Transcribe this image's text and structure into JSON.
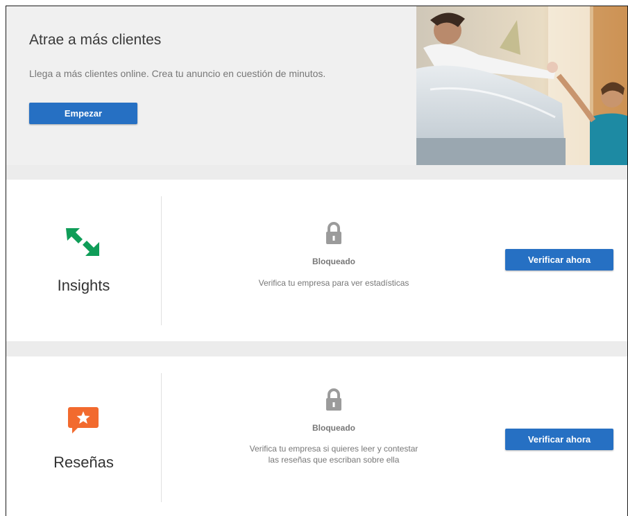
{
  "promo": {
    "title": "Atrae a más clientes",
    "description": "Llega a más clientes online. Crea tu anuncio en cuestión de minutos.",
    "start_label": "Empezar"
  },
  "insights": {
    "title": "Insights",
    "icon": "insights-arrows-icon",
    "lock_icon": "lock-icon",
    "status": "Bloqueado",
    "note": "Verifica tu empresa para ver estadísticas",
    "button_label": "Verificar ahora",
    "accent": "#0f9d58"
  },
  "reviews": {
    "title": "Reseñas",
    "icon": "star-review-icon",
    "lock_icon": "lock-icon",
    "status": "Bloqueado",
    "note": "Verifica tu empresa si quieres leer y contestar las reseñas que escriban sobre ella",
    "button_label": "Verificar ahora",
    "accent": "#f26a2e"
  },
  "colors": {
    "primary_button": "#2670c3",
    "section_gap": "#ececec"
  }
}
